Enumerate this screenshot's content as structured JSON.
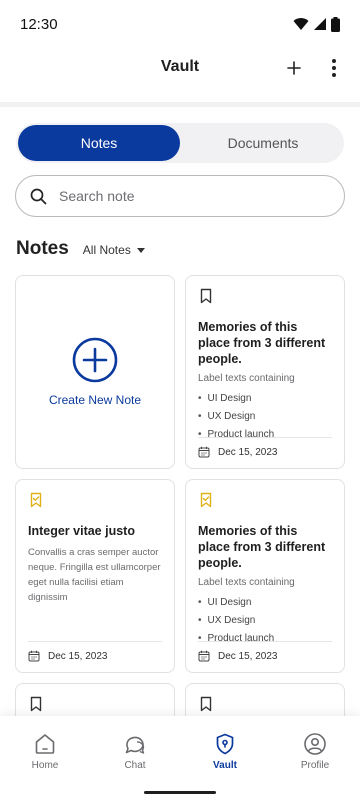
{
  "status": {
    "time": "12:30"
  },
  "app_bar": {
    "title": "Vault"
  },
  "tabs": [
    {
      "label": "Notes",
      "active": true
    },
    {
      "label": "Documents",
      "active": false
    }
  ],
  "search": {
    "placeholder": "Search note",
    "value": ""
  },
  "section": {
    "title": "Notes",
    "filter_label": "All Notes"
  },
  "create_card": {
    "label": "Create New Note"
  },
  "cards": [
    {
      "title": "Memories of this place from 3 different people.",
      "subtitle": "Label texts containing",
      "items": [
        "UI Design",
        "UX Design",
        "Product launch"
      ],
      "date": "Dec 15, 2023",
      "bookmark": "outline"
    },
    {
      "title": "Integer vitae justo",
      "body": "Convallis a cras semper auctor neque. Fringilla est ullamcorper eget nulla facilisi etiam dignissim",
      "date": "Dec 15, 2023",
      "bookmark": "checked"
    },
    {
      "title": "Memories of this place from 3 different people.",
      "subtitle": "Label texts containing",
      "items": [
        "UI Design",
        "UX Design",
        "Product launch"
      ],
      "date": "Dec 15, 2023",
      "bookmark": "checked"
    }
  ],
  "nav": [
    {
      "label": "Home",
      "icon": "home-icon",
      "active": false
    },
    {
      "label": "Chat",
      "icon": "chat-icon",
      "active": false
    },
    {
      "label": "Vault",
      "icon": "vault-shield-icon",
      "active": true
    },
    {
      "label": "Profile",
      "icon": "profile-icon",
      "active": false
    }
  ],
  "colors": {
    "primary": "#0b3a9e",
    "bookmark_checked": "#e0b21a",
    "text_muted": "#6b6b6f"
  }
}
